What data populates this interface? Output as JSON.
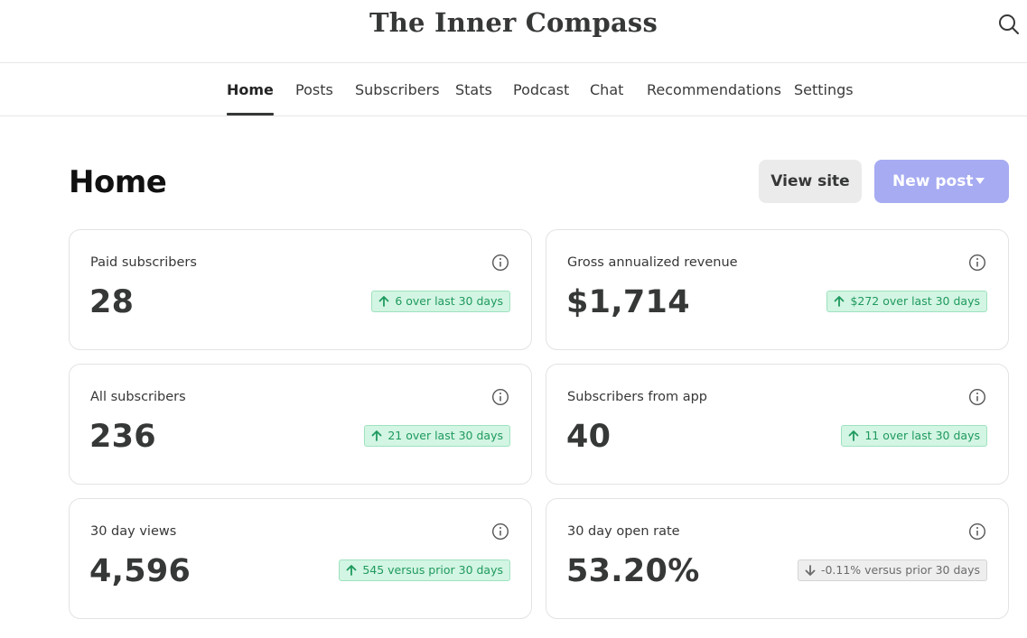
{
  "header": {
    "site_title": "The Inner Compass",
    "search_icon": "search-icon"
  },
  "nav": {
    "tabs": [
      {
        "label": "Home",
        "active": true
      },
      {
        "label": "Posts"
      },
      {
        "label": "Subscribers"
      },
      {
        "label": "Stats"
      },
      {
        "label": "Podcast"
      },
      {
        "label": "Chat"
      },
      {
        "label": "Recommendations"
      },
      {
        "label": "Settings"
      }
    ]
  },
  "page": {
    "title": "Home",
    "view_site_label": "View site",
    "new_post_label": "New post"
  },
  "colors": {
    "accent": "#a6abf2",
    "positive": "#1f9a5f",
    "neutral": "#6b6b6b"
  },
  "cards": [
    {
      "label": "Paid subscribers",
      "value": "28",
      "trend": "up",
      "badge": "6 over last 30 days"
    },
    {
      "label": "Gross annualized revenue",
      "value": "$1,714",
      "trend": "up",
      "badge": "$272 over last 30 days"
    },
    {
      "label": "All subscribers",
      "value": "236",
      "trend": "up",
      "badge": "21 over last 30 days"
    },
    {
      "label": "Subscribers from app",
      "value": "40",
      "trend": "up",
      "badge": "11 over last 30 days"
    },
    {
      "label": "30 day views",
      "value": "4,596",
      "trend": "up",
      "badge": "545 versus prior 30 days"
    },
    {
      "label": "30 day open rate",
      "value": "53.20%",
      "trend": "down",
      "badge": "-0.11% versus prior 30 days"
    }
  ]
}
